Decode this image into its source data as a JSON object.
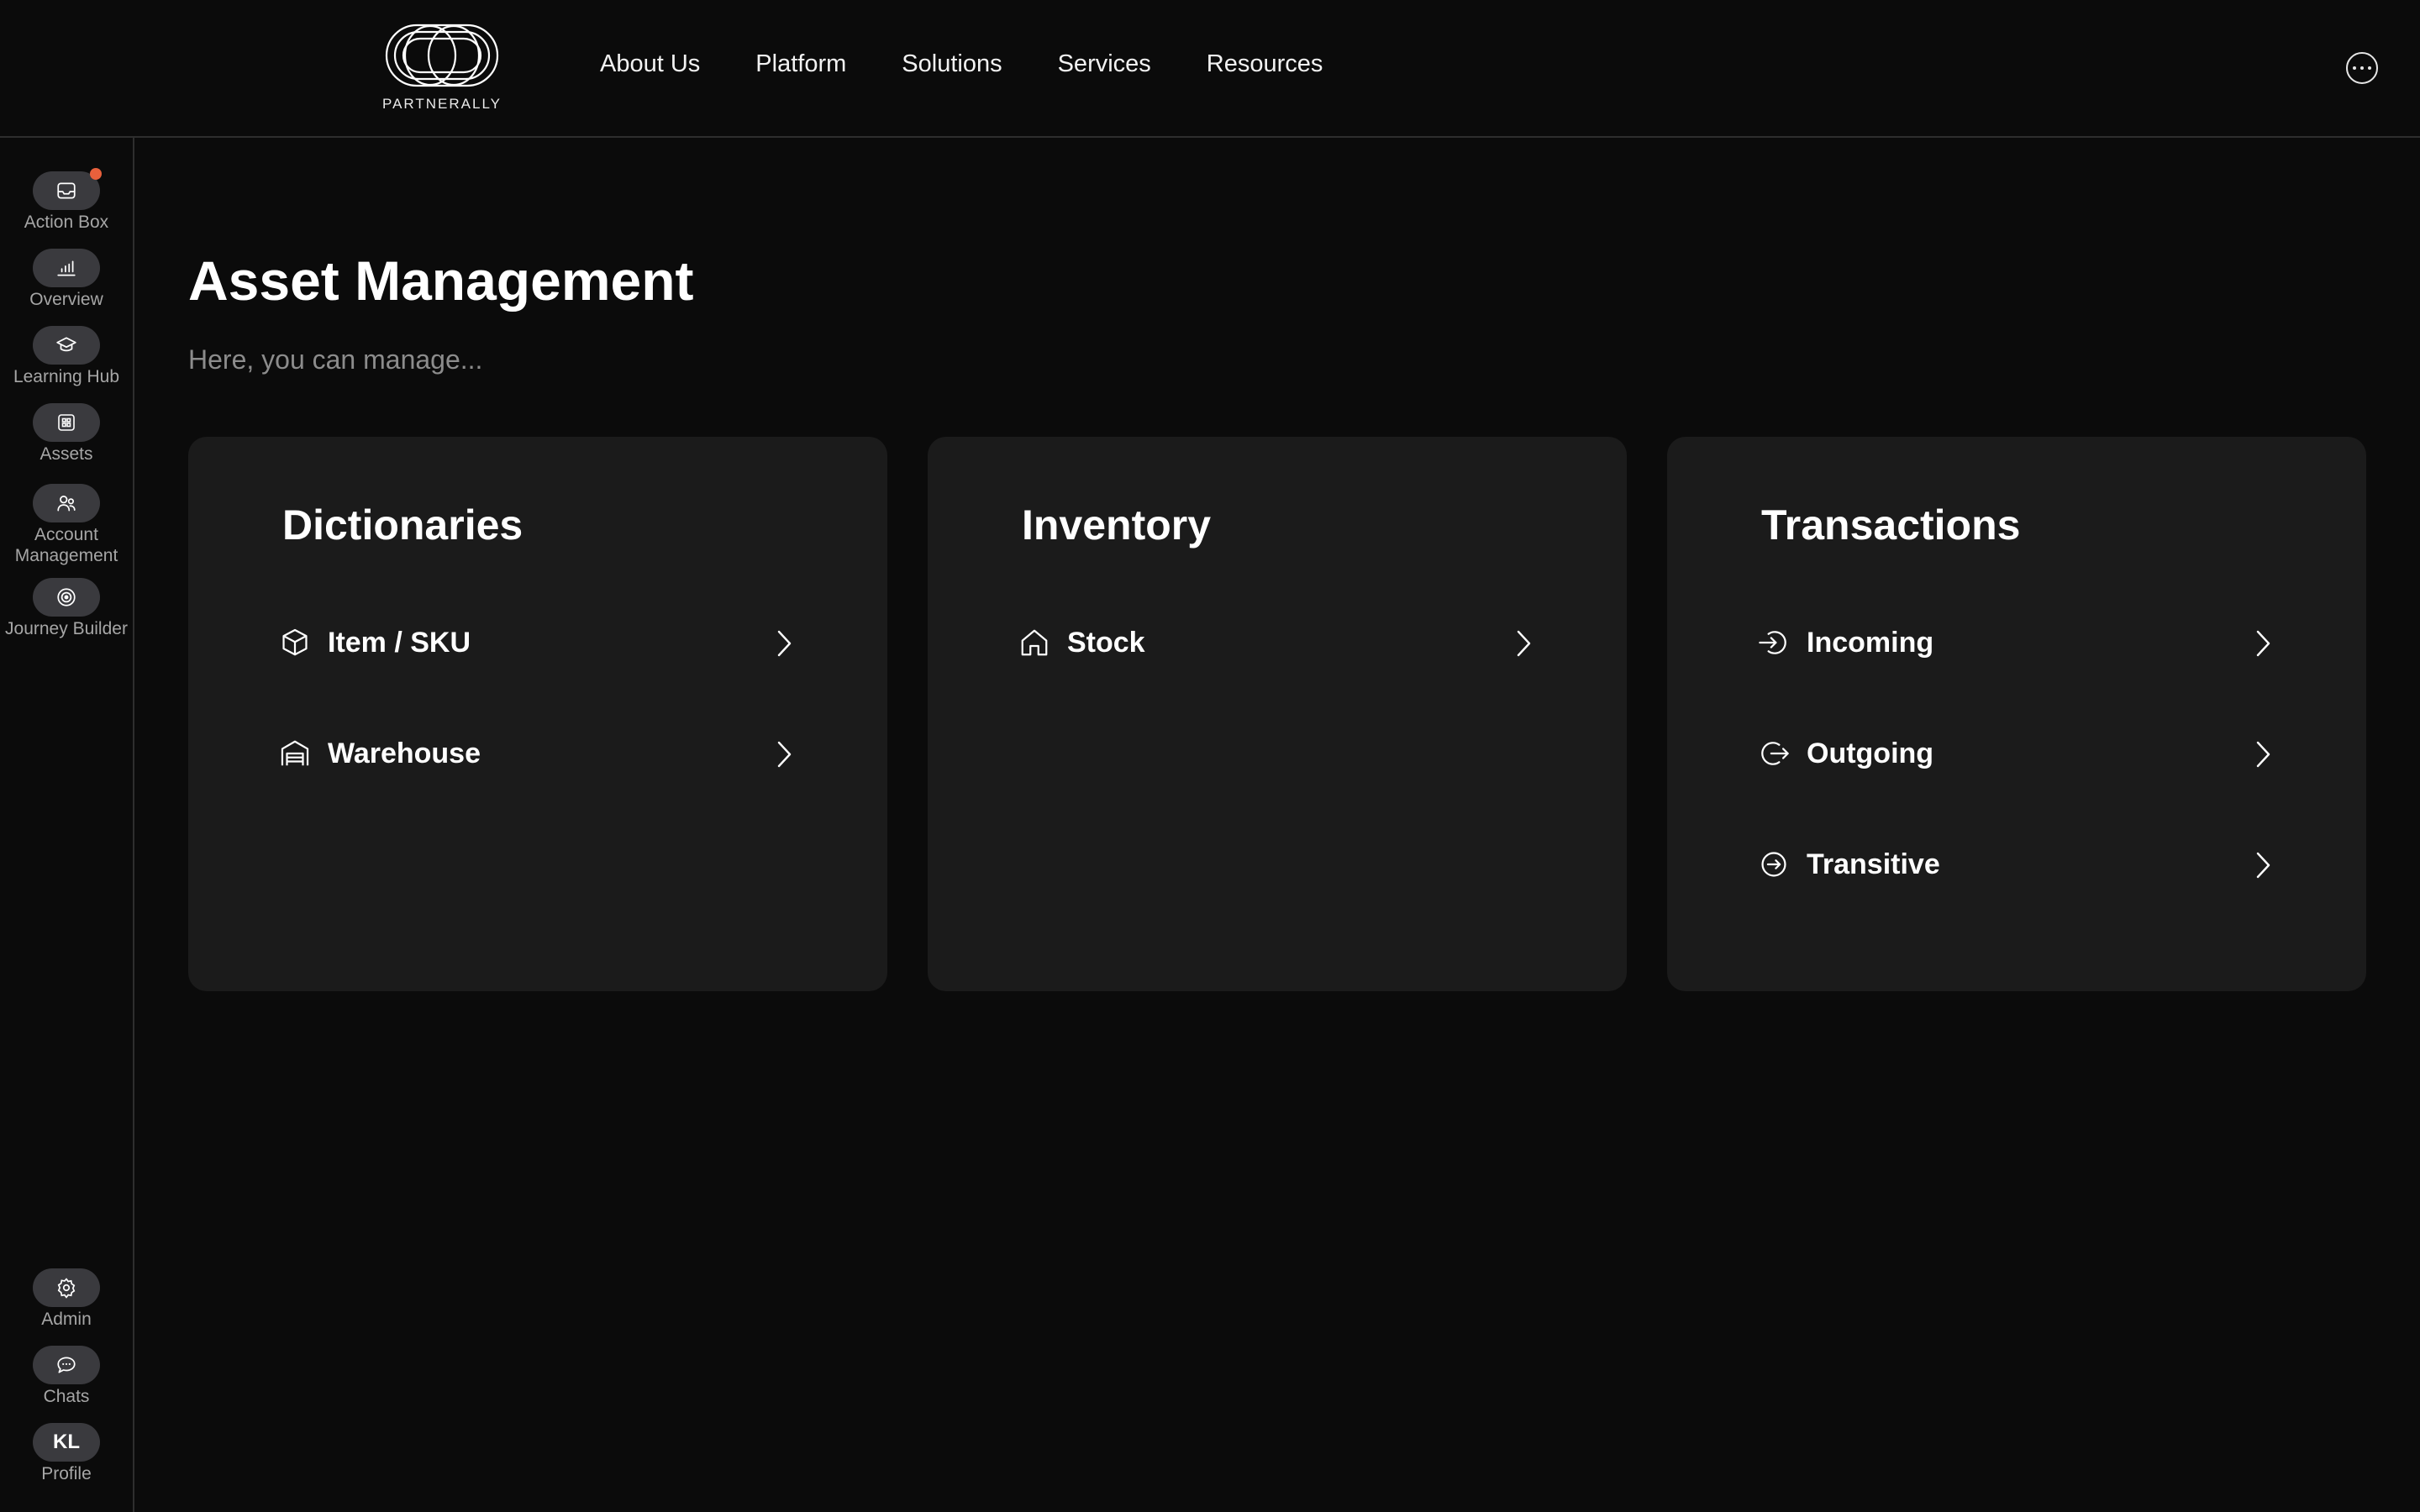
{
  "brand": {
    "name": "PARTNERALLY"
  },
  "nav": {
    "items": [
      "About Us",
      "Platform",
      "Solutions",
      "Services",
      "Resources"
    ]
  },
  "sidebar": {
    "top": [
      {
        "label": "Action Box",
        "icon": "inbox-icon",
        "notification": true
      },
      {
        "label": "Overview",
        "icon": "bar-chart-icon"
      },
      {
        "label": "Learning Hub",
        "icon": "graduation-cap-icon"
      },
      {
        "label": "Assets",
        "icon": "grid-icon"
      },
      {
        "label": "Account Management",
        "icon": "users-icon"
      },
      {
        "label": "Journey Builder",
        "icon": "target-icon"
      }
    ],
    "bottom": [
      {
        "label": "Admin",
        "icon": "gear-icon"
      },
      {
        "label": "Chats",
        "icon": "chat-icon"
      },
      {
        "label": "Profile",
        "initials": "KL"
      }
    ]
  },
  "page": {
    "title": "Asset Management",
    "subtitle": "Here, you can manage..."
  },
  "cards": [
    {
      "title": "Dictionaries",
      "items": [
        {
          "label": "Item / SKU",
          "icon": "box-icon"
        },
        {
          "label": "Warehouse",
          "icon": "warehouse-icon"
        }
      ]
    },
    {
      "title": "Inventory",
      "items": [
        {
          "label": "Stock",
          "icon": "home-icon"
        }
      ]
    },
    {
      "title": "Transactions",
      "items": [
        {
          "label": "Incoming",
          "icon": "incoming-icon"
        },
        {
          "label": "Outgoing",
          "icon": "outgoing-icon"
        },
        {
          "label": "Transitive",
          "icon": "transitive-icon"
        }
      ]
    }
  ],
  "colors": {
    "background": "#0b0b0b",
    "card": "#1b1b1b",
    "pill": "#3a3a3e",
    "notification": "#e8603c",
    "muted_text": "#8c8c8c"
  }
}
